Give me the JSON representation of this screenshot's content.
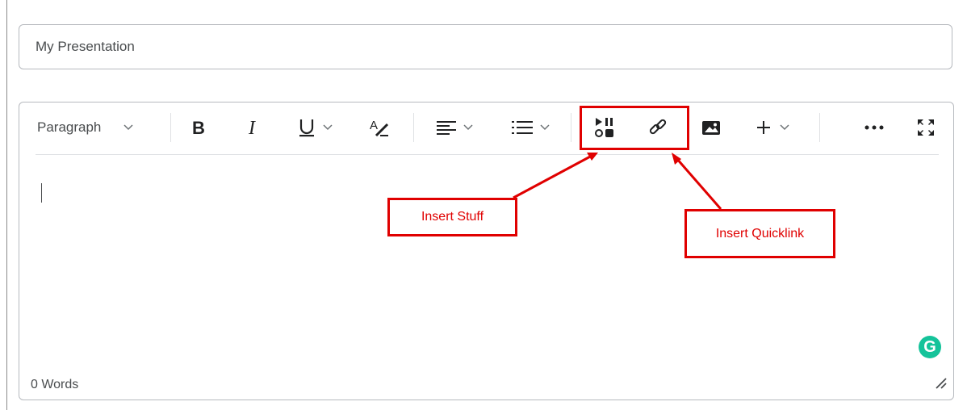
{
  "title_field": {
    "value": "My Presentation"
  },
  "toolbar": {
    "block_format": "Paragraph",
    "buttons": [
      "bold-button",
      "italic-button",
      "underline-button",
      "text-style-button",
      "align-button",
      "list-button",
      "insert-stuff-button",
      "insert-quicklink-button",
      "insert-image-button",
      "insert-more-button",
      "more-actions-button",
      "fullscreen-button"
    ]
  },
  "editor": {
    "word_count": "0 Words"
  },
  "annotations": {
    "insert_stuff": "Insert Stuff",
    "insert_quicklink": "Insert Quicklink",
    "color": "#e00000"
  },
  "grammarly": {
    "glyph": "G",
    "color": "#15c39a"
  }
}
